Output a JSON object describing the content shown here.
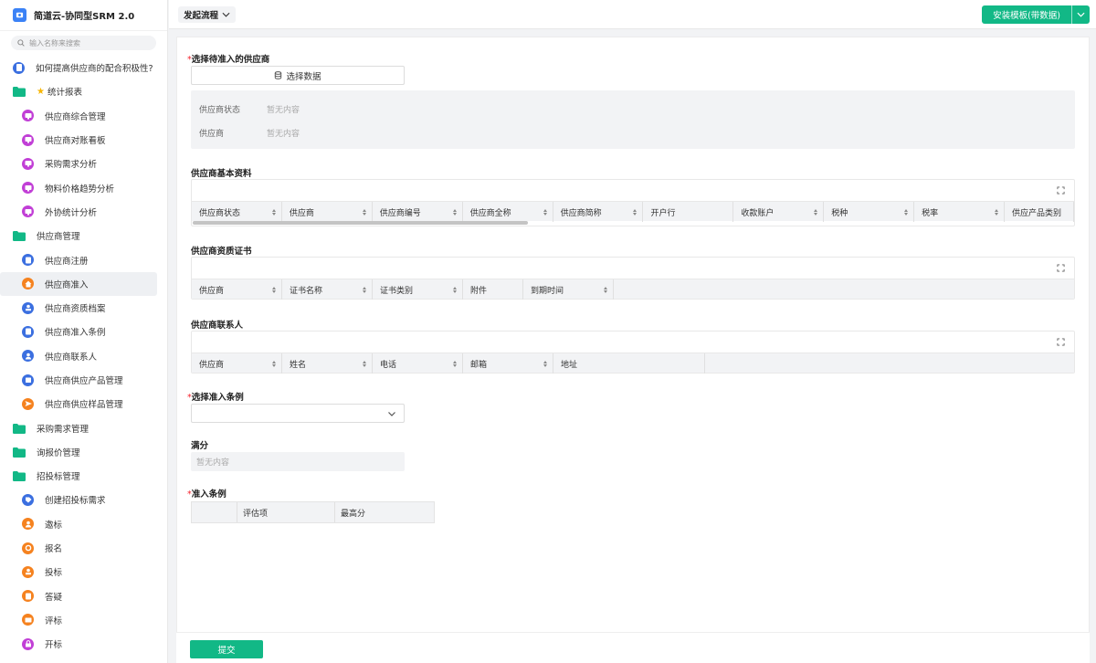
{
  "app": {
    "title": "简道云-协同型SRM 2.0"
  },
  "search": {
    "placeholder": "输入名称来搜索"
  },
  "sidebar": {
    "items": [
      {
        "label": "如何提高供应商的配合积极性?",
        "level": 0,
        "icon": "document-icon",
        "color": "#3b6fe0"
      },
      {
        "label": "统计报表",
        "level": 0,
        "icon": "folder-icon",
        "color": "#12b886",
        "star": true
      },
      {
        "label": "供应商综合管理",
        "level": 1,
        "icon": "dashboard-icon",
        "color": "#c13fd6"
      },
      {
        "label": "供应商对账看板",
        "level": 1,
        "icon": "dashboard-icon",
        "color": "#c13fd6"
      },
      {
        "label": "采购需求分析",
        "level": 1,
        "icon": "dashboard-icon",
        "color": "#c13fd6"
      },
      {
        "label": "物料价格趋势分析",
        "level": 1,
        "icon": "dashboard-icon",
        "color": "#c13fd6"
      },
      {
        "label": "外协统计分析",
        "level": 1,
        "icon": "dashboard-icon",
        "color": "#c13fd6"
      },
      {
        "label": "供应商管理",
        "level": 0,
        "icon": "folder-icon",
        "color": "#12b886"
      },
      {
        "label": "供应商注册",
        "level": 1,
        "icon": "form-icon",
        "color": "#3b6fe0"
      },
      {
        "label": "供应商准入",
        "level": 1,
        "icon": "home-icon",
        "color": "#f5821f",
        "active": true
      },
      {
        "label": "供应商资质档案",
        "level": 1,
        "icon": "stamp-icon",
        "color": "#3b6fe0"
      },
      {
        "label": "供应商准入条例",
        "level": 1,
        "icon": "form-icon",
        "color": "#3b6fe0"
      },
      {
        "label": "供应商联系人",
        "level": 1,
        "icon": "user-icon",
        "color": "#3b6fe0"
      },
      {
        "label": "供应商供应产品管理",
        "level": 1,
        "icon": "box-icon",
        "color": "#3b6fe0"
      },
      {
        "label": "供应商供应样品管理",
        "level": 1,
        "icon": "send-icon",
        "color": "#f5821f"
      },
      {
        "label": "采购需求管理",
        "level": 0,
        "icon": "folder-icon",
        "color": "#12b886"
      },
      {
        "label": "询报价管理",
        "level": 0,
        "icon": "folder-icon",
        "color": "#12b886"
      },
      {
        "label": "招投标管理",
        "level": 0,
        "icon": "folder-icon",
        "color": "#12b886"
      },
      {
        "label": "创建招投标需求",
        "level": 1,
        "icon": "tag-icon",
        "color": "#3b6fe0"
      },
      {
        "label": "邀标",
        "level": 1,
        "icon": "user-icon",
        "color": "#f5821f"
      },
      {
        "label": "报名",
        "level": 1,
        "icon": "gear-icon",
        "color": "#f5821f"
      },
      {
        "label": "投标",
        "level": 1,
        "icon": "stamp-icon",
        "color": "#f5821f"
      },
      {
        "label": "答疑",
        "level": 1,
        "icon": "form-icon",
        "color": "#f5821f"
      },
      {
        "label": "评标",
        "level": 1,
        "icon": "mail-icon",
        "color": "#f5821f"
      },
      {
        "label": "开标",
        "level": 1,
        "icon": "lock-icon",
        "color": "#c13fd6"
      }
    ]
  },
  "topbar": {
    "flow_label": "发起流程",
    "install_label": "安装模板(带数据)"
  },
  "form": {
    "supplier_select_title": "选择待准入的供应商",
    "select_data_label": "选择数据",
    "info": [
      {
        "key": "供应商状态",
        "value": "暂无内容"
      },
      {
        "key": "供应商",
        "value": "暂无内容"
      }
    ],
    "basic_title": "供应商基本资料",
    "basic_columns": [
      "供应商状态",
      "供应商",
      "供应商编号",
      "供应商全称",
      "供应商简称",
      "开户行",
      "收款账户",
      "税种",
      "税率",
      "供应产品类别"
    ],
    "cert_title": "供应商资质证书",
    "cert_columns": [
      "供应商",
      "证书名称",
      "证书类别",
      "附件",
      "到期时间"
    ],
    "contact_title": "供应商联系人",
    "contact_columns": [
      "供应商",
      "姓名",
      "电话",
      "邮箱",
      "地址"
    ],
    "rule_select_title": "选择准入条例",
    "score_title": "满分",
    "score_value": "暂无内容",
    "rules_title": "准入条例",
    "rules_columns": [
      "",
      "评估项",
      "最高分"
    ]
  },
  "footer": {
    "submit_label": "提交"
  },
  "colors": {
    "accent": "#12b886",
    "required": "#f5222d"
  }
}
